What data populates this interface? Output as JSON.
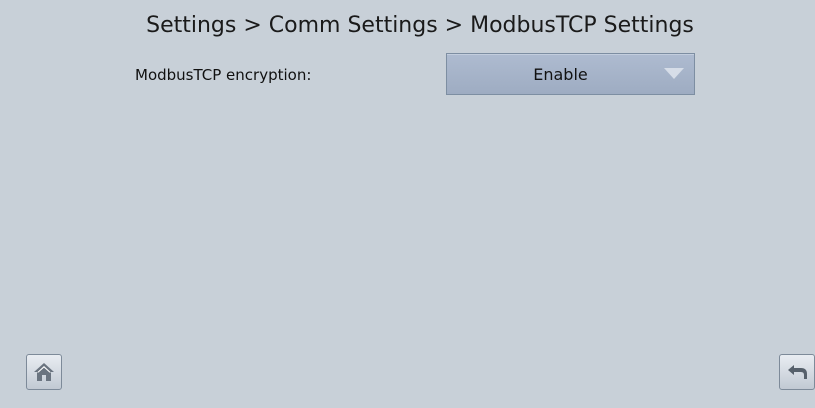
{
  "header": {
    "breadcrumb": "Settings > Comm Settings > ModbusTCP Settings"
  },
  "settings": {
    "modbustcp_encryption": {
      "label": "ModbusTCP encryption:",
      "value": "Enable"
    }
  },
  "footer": {
    "home_icon": "home-icon",
    "back_icon": "back-arrow-icon"
  }
}
